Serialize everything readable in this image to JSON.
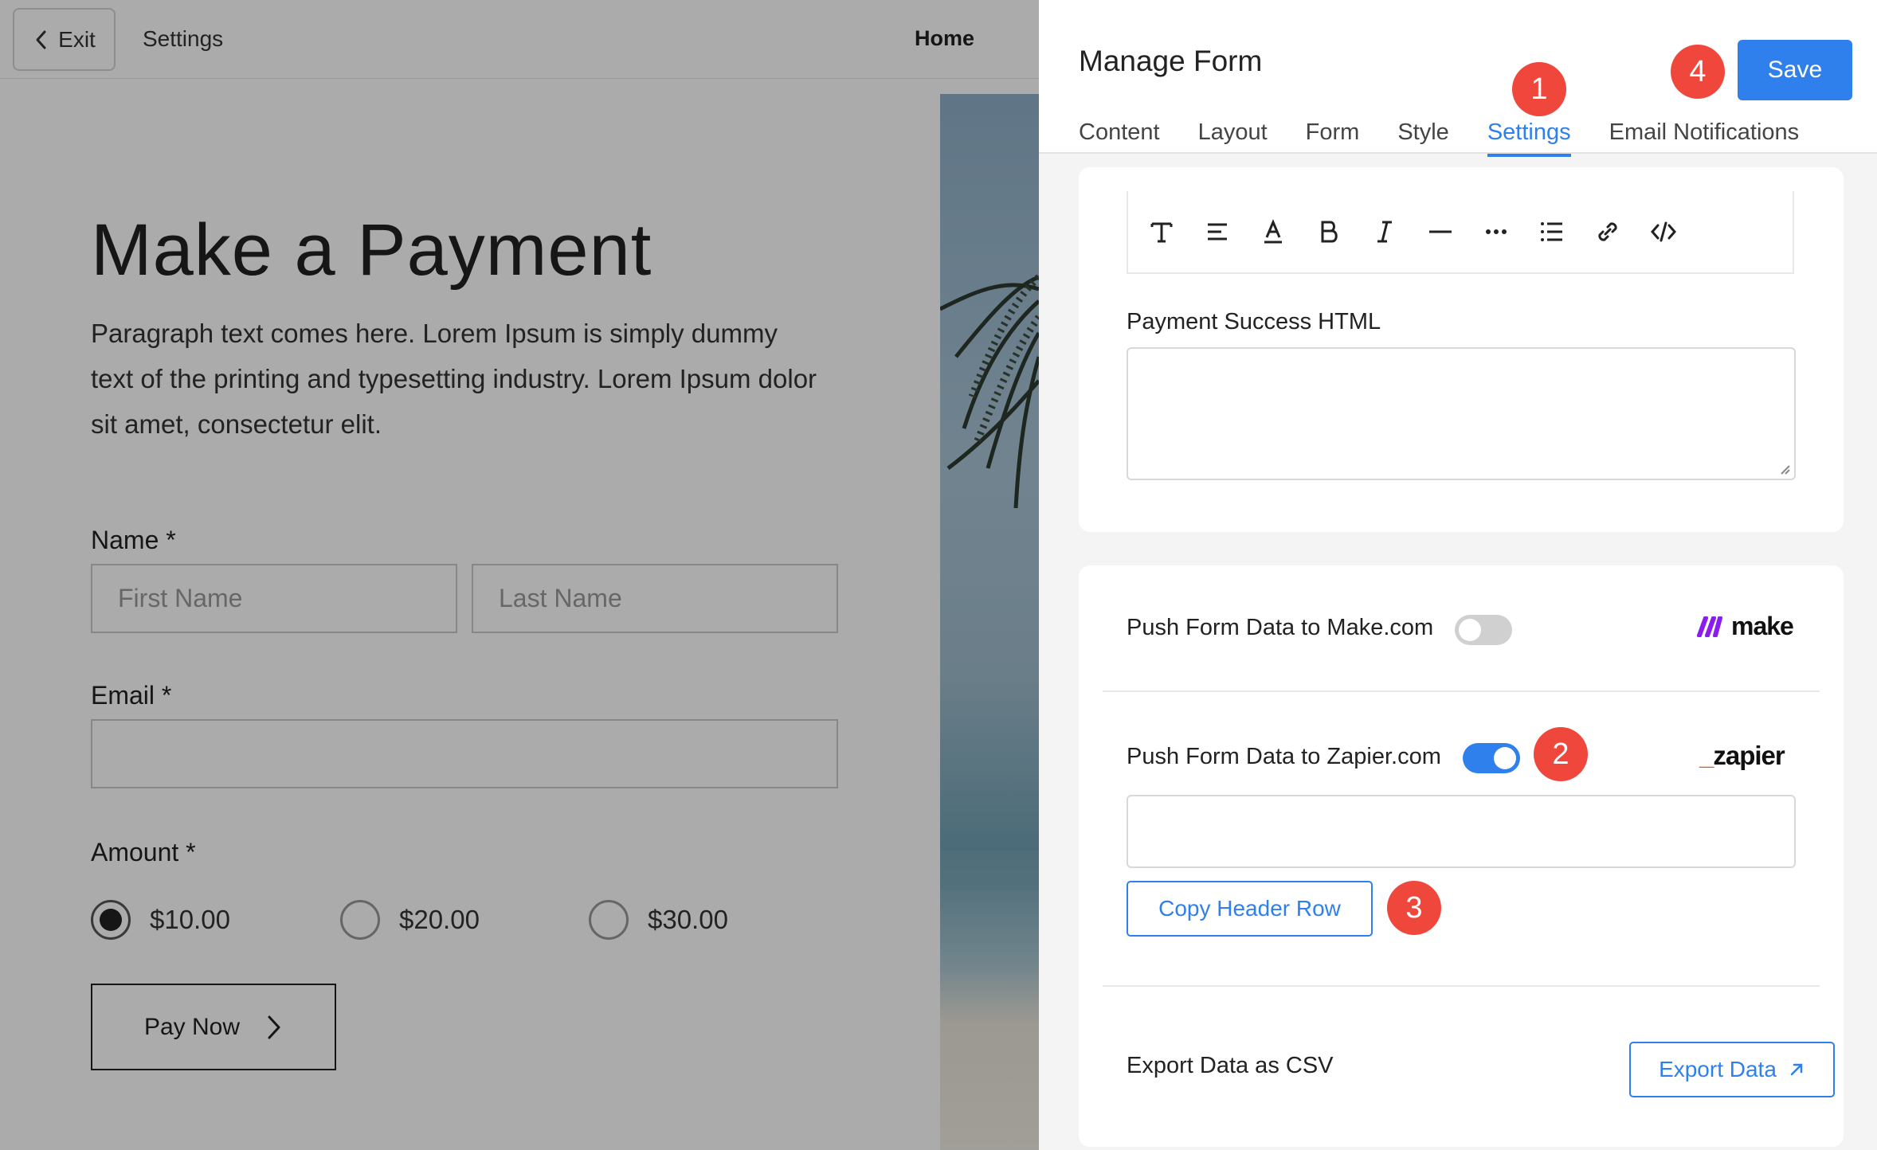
{
  "topbar": {
    "exit_label": "Exit",
    "breadcrumb": "Settings",
    "home_link": "Home"
  },
  "preview": {
    "title": "Make a Payment",
    "paragraph": "Paragraph text comes here. Lorem Ipsum is simply dummy text of the printing and typesetting industry. Lorem Ipsum dolor sit amet, consectetur elit.",
    "name_label": "Name *",
    "first_name_placeholder": "First Name",
    "last_name_placeholder": "Last Name",
    "email_label": "Email *",
    "amount_label": "Amount *",
    "amounts": [
      {
        "label": "$10.00",
        "selected": true
      },
      {
        "label": "$20.00",
        "selected": false
      },
      {
        "label": "$30.00",
        "selected": false
      }
    ],
    "pay_button": "Pay Now"
  },
  "panel": {
    "title": "Manage Form",
    "save_label": "Save",
    "tabs": [
      {
        "label": "Content",
        "active": false
      },
      {
        "label": "Layout",
        "active": false
      },
      {
        "label": "Form",
        "active": false
      },
      {
        "label": "Style",
        "active": false
      },
      {
        "label": "Settings",
        "active": true
      },
      {
        "label": "Email Notifications",
        "active": false
      }
    ],
    "toolbar_icons": [
      "text-style-icon",
      "align-icon",
      "text-color-icon",
      "bold-icon",
      "italic-icon",
      "horizontal-rule-icon",
      "more-icon",
      "list-icon",
      "link-icon",
      "code-icon"
    ],
    "success_label": "Payment Success HTML",
    "make": {
      "label": "Push Form Data to Make.com",
      "enabled": false,
      "logo_text": "make"
    },
    "zapier": {
      "label": "Push Form Data to Zapier.com",
      "enabled": true,
      "logo_text": "zapier"
    },
    "copy_header_label": "Copy Header Row",
    "export_label": "Export Data as CSV",
    "export_button": "Export Data"
  },
  "badges": [
    "1",
    "2",
    "3",
    "4"
  ],
  "colors": {
    "accent": "#2f80ed",
    "badge": "#f0473d",
    "make_brand": "#8a1cf0",
    "zapier_brand": "#ff4f00"
  }
}
